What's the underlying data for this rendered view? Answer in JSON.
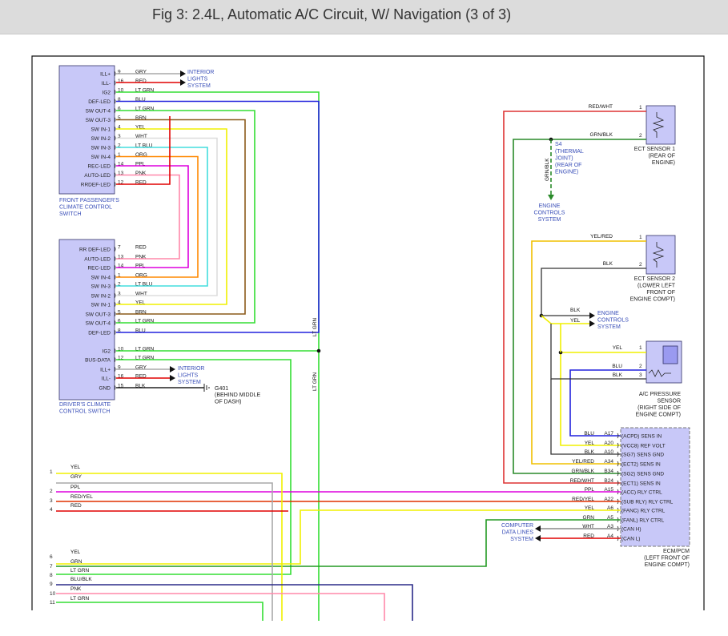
{
  "title": "Fig 3: 2.4L, Automatic A/C Circuit, W/ Navigation (3 of 3)",
  "colors": {
    "background": "#ffffff",
    "title_bar": "#dcdcdc",
    "component_fill": "#c8c8f8",
    "component_stroke": "#333366",
    "label_blue": "#3a4fb8"
  },
  "wire_colors": {
    "RED": "#e00000",
    "GRY": "#a8a8a8",
    "LT GRN": "#33dd33",
    "BLU": "#2222dd",
    "BRN": "#8b5a1a",
    "YEL": "#f0f000",
    "WHT": "#dddddd",
    "LT BLU": "#44dddd",
    "ORG": "#ff8800",
    "PPL": "#dd00dd",
    "PNK": "#ff88aa",
    "GRN": "#229922",
    "BLK": "#333333",
    "RED/WHT": "#dd3333",
    "GRN/BLK": "#2a8a2a",
    "YEL/RED": "#f0c000",
    "RED/YEL": "#e03000",
    "BLU/BLK": "#2a2a88"
  },
  "front_switch": {
    "caption": [
      "FRONT PASSENGER'S",
      "CLIMATE CONTROL",
      "SWITCH"
    ],
    "terminals": [
      {
        "name": "ILL+",
        "pin": "9",
        "wire": "GRY"
      },
      {
        "name": "ILL-",
        "pin": "16",
        "wire": "RED"
      },
      {
        "name": "IG2",
        "pin": "10",
        "wire": "LT GRN"
      },
      {
        "name": "DEF-LED",
        "pin": "8",
        "wire": "BLU"
      },
      {
        "name": "SW OUT-4",
        "pin": "6",
        "wire": "LT GRN"
      },
      {
        "name": "SW OUT-3",
        "pin": "5",
        "wire": "BRN"
      },
      {
        "name": "SW IN-1",
        "pin": "4",
        "wire": "YEL"
      },
      {
        "name": "SW IN-2",
        "pin": "3",
        "wire": "WHT"
      },
      {
        "name": "SW IN-3",
        "pin": "2",
        "wire": "LT BLU"
      },
      {
        "name": "SW IN-4",
        "pin": "1",
        "wire": "ORG"
      },
      {
        "name": "REC-LED",
        "pin": "14",
        "wire": "PPL"
      },
      {
        "name": "AUTO-LED",
        "pin": "13",
        "wire": "PNK"
      },
      {
        "name": "RRDEF-LED",
        "pin": "12",
        "wire": "RED"
      }
    ]
  },
  "driver_switch": {
    "caption": [
      "DRIVER'S CLIMATE",
      "CONTROL SWITCH"
    ],
    "terminals": [
      {
        "name": "RR DEF-LED",
        "pin": "7",
        "wire": "RED"
      },
      {
        "name": "AUTO-LED",
        "pin": "13",
        "wire": "PNK"
      },
      {
        "name": "REC-LED",
        "pin": "14",
        "wire": "PPL"
      },
      {
        "name": "SW IN-4",
        "pin": "1",
        "wire": "ORG"
      },
      {
        "name": "SW IN-3",
        "pin": "2",
        "wire": "LT BLU"
      },
      {
        "name": "SW IN-2",
        "pin": "3",
        "wire": "WHT"
      },
      {
        "name": "SW IN-1",
        "pin": "4",
        "wire": "YEL"
      },
      {
        "name": "SW OUT-3",
        "pin": "5",
        "wire": "BRN"
      },
      {
        "name": "SW OUT-4",
        "pin": "6",
        "wire": "LT GRN"
      },
      {
        "name": "DEF-LED",
        "pin": "8",
        "wire": "BLU"
      },
      {
        "name": "IG2",
        "pin": "10",
        "wire": "LT GRN"
      },
      {
        "name": "BUS-DATA",
        "pin": "12",
        "wire": "LT GRN"
      },
      {
        "name": "ILL+",
        "pin": "9",
        "wire": "GRY"
      },
      {
        "name": "ILL-",
        "pin": "16",
        "wire": "RED"
      },
      {
        "name": "GND",
        "pin": "15",
        "wire": "BLK"
      }
    ]
  },
  "interior_lights_1": [
    "INTERIOR",
    "LIGHTS",
    "SYSTEM"
  ],
  "interior_lights_2": [
    "INTERIOR",
    "LIGHTS",
    "SYSTEM"
  ],
  "ground": {
    "name": "G401",
    "lines": [
      "(BEHIND MIDDLE",
      "OF DASH)"
    ]
  },
  "vertical_lt_grn_label": "LT GRN",
  "vertical_lt_grn_label2": "LT GRN",
  "ect1": {
    "pins": [
      "1",
      "2"
    ],
    "wires": [
      "RED/WHT",
      "GRN/BLK"
    ],
    "caption": [
      "ECT SENSOR 1",
      "(REAR OF",
      "ENGINE)"
    ]
  },
  "s4": {
    "name": "S4",
    "lines": [
      "(THERMAL",
      "JOINT)",
      "(REAR OF",
      "ENGINE)"
    ],
    "wire": "GRN/BLK",
    "dest": [
      "ENGINE",
      "CONTROLS",
      "SYSTEM"
    ]
  },
  "ect2": {
    "pins": [
      "1",
      "2"
    ],
    "wires": [
      "YEL/RED",
      "BLK"
    ],
    "caption": [
      "ECT SENSOR 2",
      "(LOWER LEFT",
      "FRONT OF",
      "ENGINE COMPT)"
    ]
  },
  "engine_controls": {
    "wires": [
      "BLK",
      "YEL"
    ],
    "lines": [
      "ENGINE",
      "CONTROLS",
      "SYSTEM"
    ]
  },
  "ac_sensor": {
    "pins": [
      "1",
      "2",
      "3"
    ],
    "wires": [
      "YEL",
      "BLU",
      "BLK"
    ],
    "caption": [
      "A/C PRESSURE",
      "SENSOR",
      "(RIGHT SIDE OF",
      "ENGINE COMPT)"
    ]
  },
  "ecm": {
    "caption": [
      "ECM/PCM",
      "(LEFT FRONT OF",
      "ENGINE COMPT)"
    ],
    "terminals": [
      {
        "wire": "BLU",
        "pin": "A17",
        "name": "(ACPD) SENS IN"
      },
      {
        "wire": "YEL",
        "pin": "A20",
        "name": "(VCC8) REF VOLT"
      },
      {
        "wire": "BLK",
        "pin": "A10",
        "name": "(SG7) SENS GND"
      },
      {
        "wire": "YEL/RED",
        "pin": "A34",
        "name": "(ECT2) SENS IN"
      },
      {
        "wire": "GRN/BLK",
        "pin": "B34",
        "name": "(SG2) SENS GND"
      },
      {
        "wire": "RED/WHT",
        "pin": "B24",
        "name": "(ECT1) SENS IN"
      },
      {
        "wire": "PPL",
        "pin": "A15",
        "name": "(ACC) RLY CTRL"
      },
      {
        "wire": "RED/YEL",
        "pin": "A22",
        "name": "(SUB RLY) RLY CTRL"
      },
      {
        "wire": "YEL",
        "pin": "A6",
        "name": "(FANC) RLY CTRL"
      },
      {
        "wire": "GRN",
        "pin": "A5",
        "name": "(FANL) RLY CTRL"
      },
      {
        "wire": "WHT",
        "pin": "A3",
        "name": "(CAN H)"
      },
      {
        "wire": "RED",
        "pin": "A4",
        "name": "(CAN L)"
      }
    ]
  },
  "data_lines": [
    "COMPUTER",
    "DATA LINES",
    "SYSTEM"
  ],
  "left_wires": [
    {
      "num": "1",
      "wire": "YEL"
    },
    {
      "num": "",
      "wire": "GRY"
    },
    {
      "num": "2",
      "wire": "PPL"
    },
    {
      "num": "3",
      "wire": "RED/YEL"
    },
    {
      "num": "4",
      "wire": "RED"
    },
    {
      "num": "5",
      "wire": ""
    },
    {
      "num": "6",
      "wire": "YEL"
    },
    {
      "num": "7",
      "wire": "GRN"
    },
    {
      "num": "8",
      "wire": "LT GRN"
    },
    {
      "num": "9",
      "wire": "BLU/BLK"
    },
    {
      "num": "10",
      "wire": "PNK"
    },
    {
      "num": "11",
      "wire": "LT GRN"
    }
  ]
}
